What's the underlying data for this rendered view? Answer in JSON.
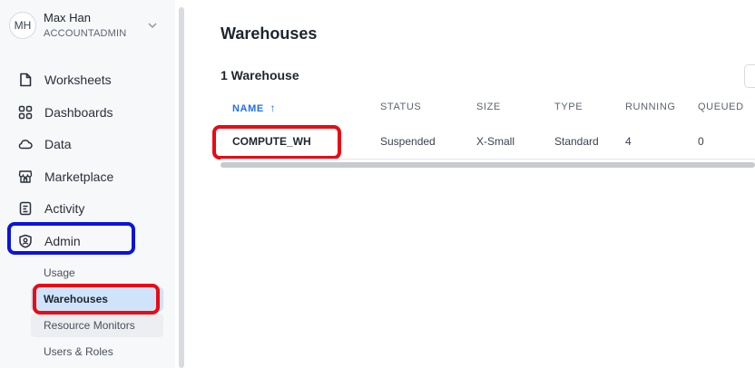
{
  "user": {
    "initials": "MH",
    "name": "Max Han",
    "role": "ACCOUNTADMIN"
  },
  "nav": {
    "worksheets": "Worksheets",
    "dashboards": "Dashboards",
    "data": "Data",
    "marketplace": "Marketplace",
    "activity": "Activity",
    "admin": "Admin"
  },
  "admin_sub": {
    "usage": "Usage",
    "warehouses": "Warehouses",
    "resource_monitors": "Resource Monitors",
    "users_roles": "Users & Roles"
  },
  "main": {
    "title": "Warehouses",
    "count": "1 Warehouse",
    "columns": {
      "name": "NAME",
      "sort_indicator": "↑",
      "status": "STATUS",
      "size": "SIZE",
      "type": "TYPE",
      "running": "RUNNING",
      "queued": "QUEUED"
    },
    "rows": [
      {
        "name": "COMPUTE_WH",
        "status": "Suspended",
        "size": "X-Small",
        "type": "Standard",
        "running": "4",
        "queued": "0"
      }
    ]
  },
  "colors": {
    "highlight_blue": "#0a14d8",
    "highlight_red": "#ea0a14",
    "active_bg": "#cfe3fa",
    "sort_accent": "#1f6ff2"
  },
  "icons": {
    "user_menu": "chevron-down-icon",
    "worksheets": "document-icon",
    "dashboards": "grid-icon",
    "data": "cloud-icon",
    "marketplace": "storefront-icon",
    "activity": "list-icon",
    "admin": "shield-icon"
  }
}
